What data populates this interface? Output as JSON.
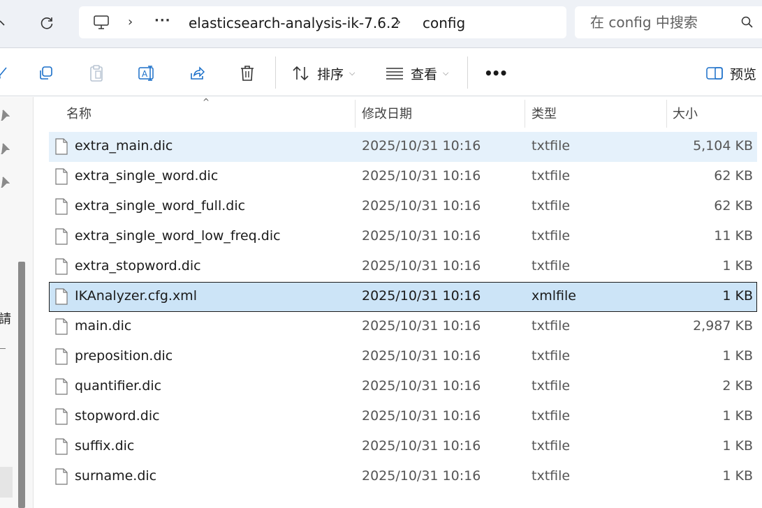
{
  "address_bar": {
    "crumbs": [
      "elasticsearch-analysis-ik-7.6.2",
      "config"
    ],
    "search_placeholder": "在 config 中搜索"
  },
  "toolbar": {
    "sort_label": "排序",
    "view_label": "查看",
    "more_label": "•••",
    "preview_label": "预览"
  },
  "left_pane": {
    "visible_glyph": "請"
  },
  "columns": {
    "name": "名称",
    "modified": "修改日期",
    "type": "类型",
    "size": "大小"
  },
  "files": [
    {
      "name": "extra_main.dic",
      "modified": "2025/10/31 10:16",
      "type": "txtfile",
      "size": "5,104 KB"
    },
    {
      "name": "extra_single_word.dic",
      "modified": "2025/10/31 10:16",
      "type": "txtfile",
      "size": "62 KB"
    },
    {
      "name": "extra_single_word_full.dic",
      "modified": "2025/10/31 10:16",
      "type": "txtfile",
      "size": "62 KB"
    },
    {
      "name": "extra_single_word_low_freq.dic",
      "modified": "2025/10/31 10:16",
      "type": "txtfile",
      "size": "11 KB"
    },
    {
      "name": "extra_stopword.dic",
      "modified": "2025/10/31 10:16",
      "type": "txtfile",
      "size": "1 KB"
    },
    {
      "name": "IKAnalyzer.cfg.xml",
      "modified": "2025/10/31 10:16",
      "type": "xmlfile",
      "size": "1 KB"
    },
    {
      "name": "main.dic",
      "modified": "2025/10/31 10:16",
      "type": "txtfile",
      "size": "2,987 KB"
    },
    {
      "name": "preposition.dic",
      "modified": "2025/10/31 10:16",
      "type": "txtfile",
      "size": "1 KB"
    },
    {
      "name": "quantifier.dic",
      "modified": "2025/10/31 10:16",
      "type": "txtfile",
      "size": "2 KB"
    },
    {
      "name": "stopword.dic",
      "modified": "2025/10/31 10:16",
      "type": "txtfile",
      "size": "1 KB"
    },
    {
      "name": "suffix.dic",
      "modified": "2025/10/31 10:16",
      "type": "txtfile",
      "size": "1 KB"
    },
    {
      "name": "surname.dic",
      "modified": "2025/10/31 10:16",
      "type": "txtfile",
      "size": "1 KB"
    }
  ],
  "state": {
    "hover_row": "extra_main.dic",
    "selected_row": "IKAnalyzer.cfg.xml"
  },
  "colors": {
    "hover": "#e5f1fb",
    "selected": "#cce4f7",
    "accent": "#1a6fc9"
  }
}
